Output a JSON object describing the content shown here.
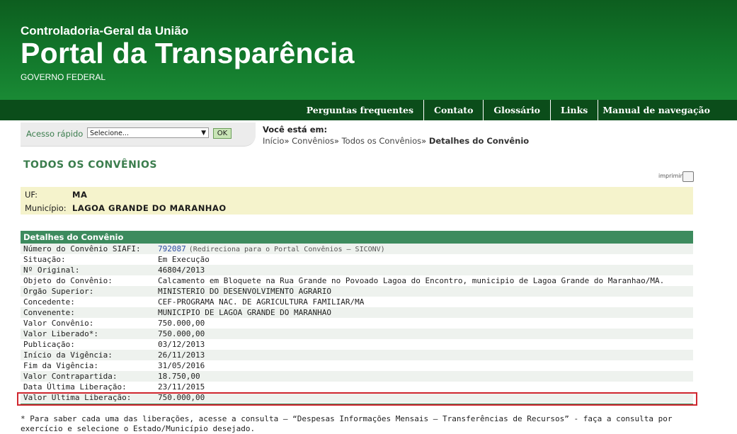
{
  "header": {
    "org": "Controladoria-Geral da União",
    "portal": "Portal da Transparência",
    "gov": "GOVERNO FEDERAL"
  },
  "nav": [
    "Perguntas frequentes",
    "Contato",
    "Glossário",
    "Links",
    "Manual de navegação"
  ],
  "quick": {
    "label": "Acesso rápido",
    "select": "Selecione...",
    "ok": "OK"
  },
  "breadcrumb": {
    "where": "Você está em:",
    "items": [
      "Início",
      "Convênios",
      "Todos os Convênios"
    ],
    "current": "Detalhes do Convênio"
  },
  "title": "TODOS OS CONVÊNIOS",
  "print_label": "imprimir",
  "place": {
    "uf_label": "UF:",
    "uf": "MA",
    "mun_label": "Município:",
    "mun": "LAGOA GRANDE DO MARANHAO"
  },
  "details": {
    "header": "Detalhes do Convênio",
    "rows": [
      {
        "k": "Número do Convênio SIAFI:",
        "v": "792087",
        "note": "(Redireciona para o Portal Convênios – SICONV)"
      },
      {
        "k": "Situação:",
        "v": "Em Execução"
      },
      {
        "k": "Nº Original:",
        "v": "46804/2013"
      },
      {
        "k": "Objeto do Convênio:",
        "v": "Calcamento em Bloquete na Rua Grande no Povoado Lagoa do Encontro, municipio de Lagoa Grande do Maranhao/MA."
      },
      {
        "k": "Orgão Superior:",
        "v": "MINISTERIO DO DESENVOLVIMENTO AGRARIO"
      },
      {
        "k": "Concedente:",
        "v": "CEF-PROGRAMA NAC. DE AGRICULTURA FAMILIAR/MA"
      },
      {
        "k": "Convenente:",
        "v": "MUNICIPIO DE LAGOA GRANDE DO MARANHAO"
      },
      {
        "k": "Valor Convênio:",
        "v": "750.000,00"
      },
      {
        "k": "Valor Liberado*:",
        "v": "750.000,00"
      },
      {
        "k": "Publicação:",
        "v": "03/12/2013"
      },
      {
        "k": "Início da Vigência:",
        "v": "26/11/2013"
      },
      {
        "k": "Fim da Vigência:",
        "v": "31/05/2016"
      },
      {
        "k": "Valor Contrapartida:",
        "v": "18.750,00"
      },
      {
        "k": "Data Última Liberação:",
        "v": "23/11/2015"
      },
      {
        "k": "Valor Ultima Liberação:",
        "v": "750.000,00"
      }
    ]
  },
  "footnote": "* Para saber cada uma das liberações, acesse a consulta – “Despesas Informações Mensais – Transferências de Recursos” - faça a consulta por exercício e selecione o Estado/Município desejado."
}
